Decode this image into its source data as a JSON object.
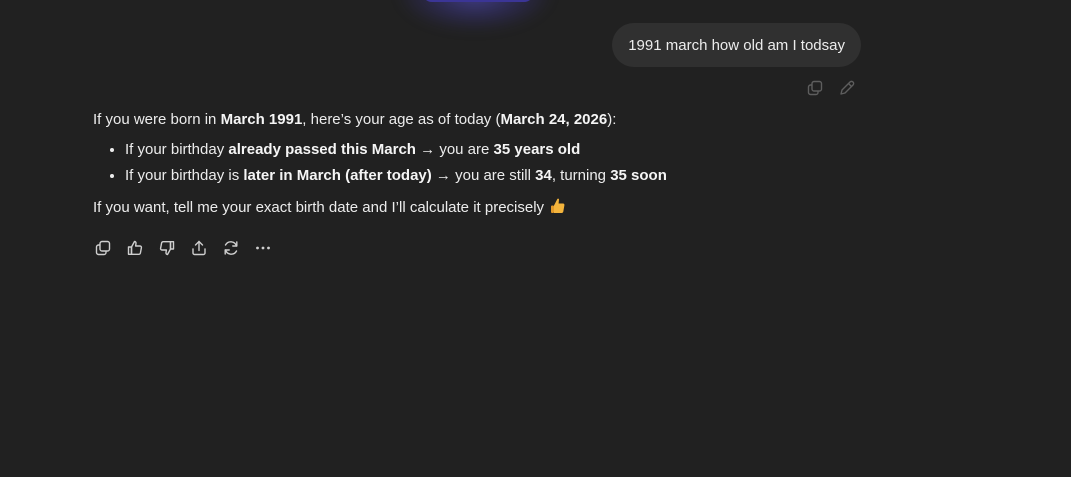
{
  "user_message": {
    "text": "1991 march how old am I todsay"
  },
  "user_actions": {
    "copy_icon": "copy-icon",
    "edit_icon": "pencil-icon"
  },
  "assistant": {
    "intro": {
      "t1": "If you were born in ",
      "b1": "March 1991",
      "t2": ", here’s your age as of today (",
      "b2": "March 24, 2026",
      "t3": "):"
    },
    "bullets": [
      {
        "t1": "If your birthday ",
        "b1": "already passed this March",
        "t2": " → you are ",
        "b2": "35 years old",
        "t3": "",
        "b3": "",
        "t4": ""
      },
      {
        "t1": "If your birthday is ",
        "b1": "later in March (after today)",
        "t2": " → you are still ",
        "b2": "34",
        "t3": ", turning ",
        "b3": "35 soon",
        "t4": ""
      }
    ],
    "closing": "If you want, tell me your exact birth date and I’ll calculate it precisely",
    "closing_emoji": "thumbs-up-emoji"
  },
  "assistant_actions": [
    {
      "icon": "copy-icon"
    },
    {
      "icon": "thumbs-up-icon"
    },
    {
      "icon": "thumbs-down-icon"
    },
    {
      "icon": "share-icon"
    },
    {
      "icon": "regenerate-icon"
    },
    {
      "icon": "more-icon"
    }
  ],
  "colors": {
    "background": "#212121",
    "user_bubble": "#303030",
    "text": "#ececec",
    "glow": "#3b3596"
  }
}
